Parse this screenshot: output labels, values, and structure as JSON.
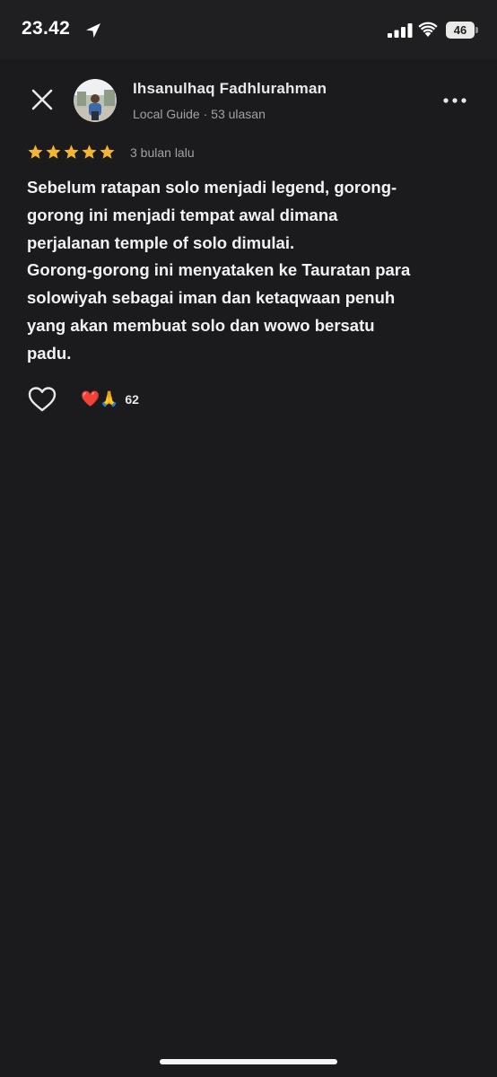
{
  "status_bar": {
    "time": "23.42",
    "battery": "46",
    "icons": [
      "location-arrow-icon",
      "cellular-signal-icon",
      "wifi-icon",
      "battery-icon"
    ]
  },
  "header": {
    "close_icon": "close-icon",
    "reviewer_name": "Ihsanulhaq Fadhlurahman",
    "reviewer_meta": "Local Guide · 53 ulasan",
    "more_icon": "more-options-icon"
  },
  "review": {
    "rating": 5,
    "max_rating": 5,
    "date": "3 bulan lalu",
    "text": "Sebelum ratapan solo menjadi legend, gorong-\ngorong ini menjadi tempat awal dimana\nperjalanan temple of solo dimulai.\nGorong-gorong ini menyataken ke Tauratan para\nsolowiyah sebagai iman dan ketaqwaan penuh\nyang akan membuat solo dan wowo bersatu\npadu."
  },
  "reactions": {
    "like_icon": "heart-outline-icon",
    "emojis": "❤️🙏",
    "count": "62"
  },
  "colors": {
    "background": "#1b1b1e",
    "star": "#f3b431",
    "text_primary": "#f2f2f4",
    "text_secondary": "#a2a2a6"
  }
}
